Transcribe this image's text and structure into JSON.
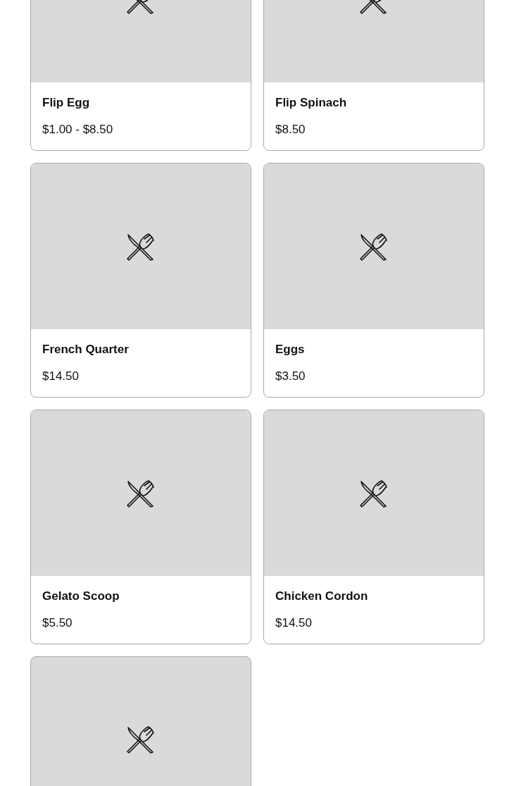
{
  "items": [
    {
      "name": "Flip Egg",
      "price": "$1.00 - $8.50"
    },
    {
      "name": "Flip Spinach",
      "price": "$8.50"
    },
    {
      "name": "French Quarter",
      "price": "$14.50"
    },
    {
      "name": "Eggs",
      "price": "$3.50"
    },
    {
      "name": "Gelato Scoop",
      "price": "$5.50"
    },
    {
      "name": "Chicken Cordon",
      "price": "$14.50"
    },
    {
      "kind": "picture"
    }
  ]
}
